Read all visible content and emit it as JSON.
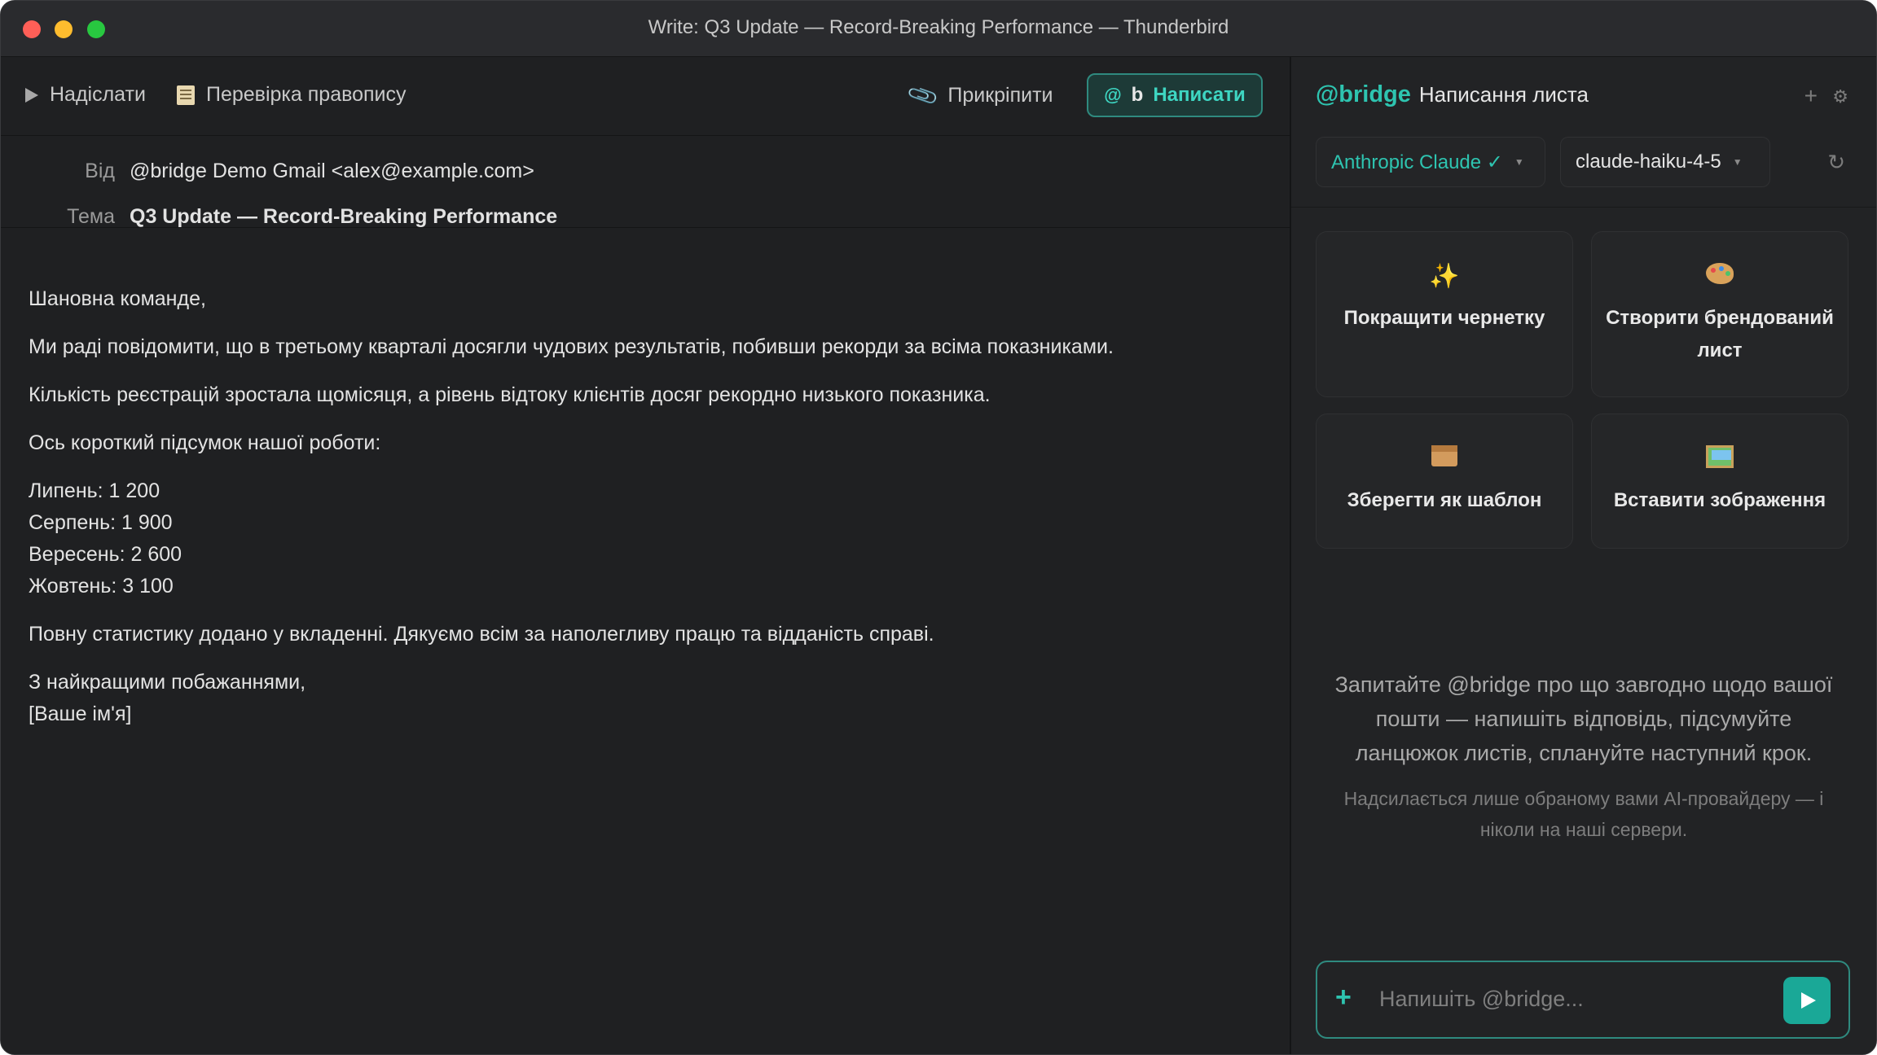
{
  "window": {
    "title": "Write: Q3 Update — Record-Breaking Performance — Thunderbird"
  },
  "toolbar": {
    "send_label": "Надіслати",
    "spellcheck_label": "Перевірка правопису",
    "attach_label": "Прикріпити",
    "write_label": "Написати",
    "write_prefix": "b"
  },
  "headers": {
    "from_label": "Від",
    "from_value": "@bridge Demo Gmail <alex@example.com>",
    "subject_label": "Тема",
    "subject_value": "Q3 Update — Record-Breaking Performance"
  },
  "body": {
    "greeting": "Шановна команде,",
    "p1": "Ми раді повідомити, що в третьому кварталі досягли чудових результатів, побивши рекорди за всіма показниками.",
    "p2": "Кількість реєстрацій зростала щомісяця, а рівень відтоку клієнтів досяг рекордно низького показника.",
    "p3": "Ось короткий підсумок нашої роботи:",
    "list": [
      "Липень: 1 200",
      "Серпень: 1 900",
      "Вересень: 2 600",
      "Жовтень: 3 100"
    ],
    "p4": "Повну статистику додано у вкладенні. Дякуємо всім за наполегливу працю та відданість справі.",
    "closing": "З найкращими побажаннями,",
    "signature": "[Ваше ім'я]"
  },
  "bridge": {
    "brand": "@bridge",
    "title": "Написання листа",
    "provider": "Anthropic Claude ✓",
    "model": "claude-haiku-4-5",
    "cards": [
      {
        "label": "Покращити чернетку",
        "icon": "sparkles-icon"
      },
      {
        "label": "Створити брендований лист",
        "icon": "palette-icon"
      },
      {
        "label": "Зберегти як шаблон",
        "icon": "box-icon"
      },
      {
        "label": "Вставити зображення",
        "icon": "picture-icon"
      }
    ],
    "hint": "Запитайте @bridge про що завгодно щодо вашої пошти — напишіть відповідь, підсумуйте ланцюжок листів, сплануйте наступний крок.",
    "privacy_note": "Надсилається лише обраному вами AI-провайдеру — і ніколи на наші сервери.",
    "input_placeholder": "Напишіть @bridge..."
  },
  "colors": {
    "accent": "#2ec4b0",
    "background": "#1f2022"
  }
}
